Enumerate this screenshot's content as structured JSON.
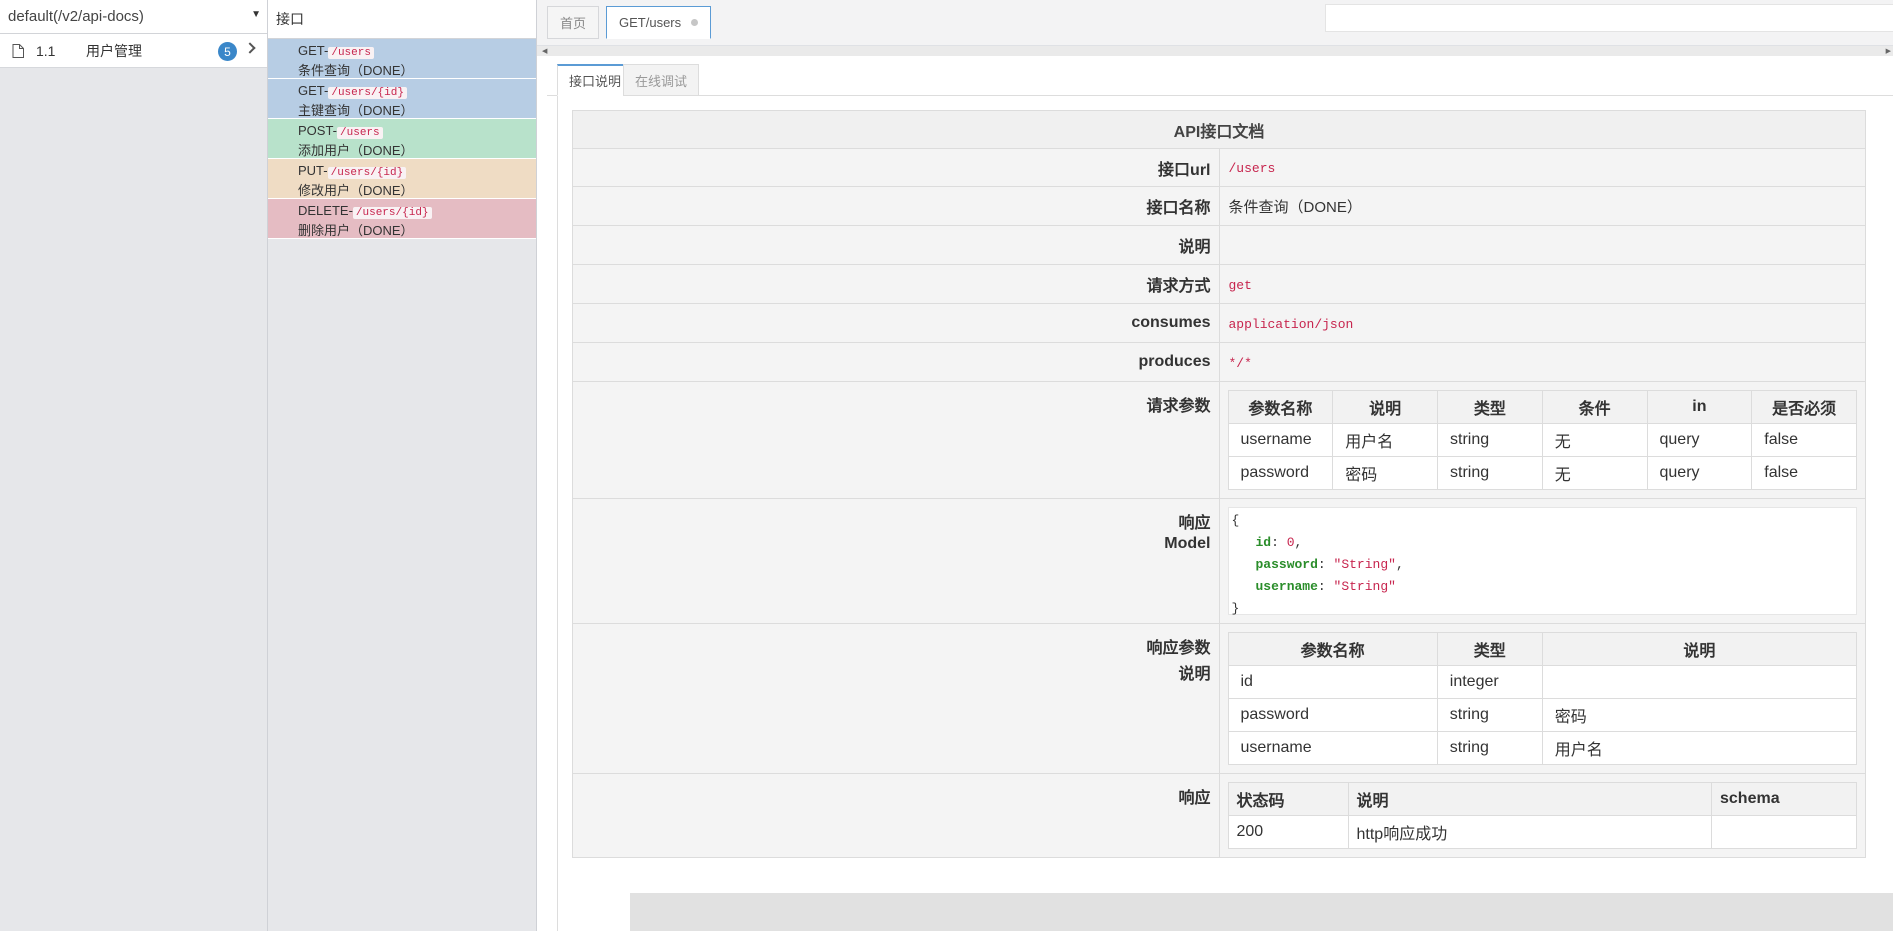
{
  "left": {
    "api_select": "default(/v2/api-docs)",
    "group": {
      "index": "1.1",
      "name": "用户管理",
      "count": "5"
    }
  },
  "middle": {
    "header": "接口",
    "endpoints": [
      {
        "method": "GET-",
        "path": "/users",
        "name": "条件查询（DONE）"
      },
      {
        "method": "GET-",
        "path": "/users/{id}",
        "name": "主键查询（DONE）"
      },
      {
        "method": "POST-",
        "path": "/users",
        "name": "添加用户（DONE）"
      },
      {
        "method": "PUT-",
        "path": "/users/{id}",
        "name": "修改用户（DONE）"
      },
      {
        "method": "DELETE-",
        "path": "/users/{id}",
        "name": "删除用户（DONE）"
      }
    ]
  },
  "tabs": {
    "home": "首页",
    "current": "GET/users"
  },
  "subtabs": {
    "desc": "接口说明",
    "debug": "在线调试"
  },
  "doc": {
    "title": "API接口文档",
    "labels": {
      "url": "接口url",
      "name": "接口名称",
      "desc": "说明",
      "method": "请求方式",
      "consumes": "consumes",
      "produces": "produces",
      "params": "请求参数",
      "model_1": "响应",
      "model_2": "Model",
      "resp_params_1": "响应参数",
      "resp_params_2": "说明",
      "response": "响应"
    },
    "url": "/users",
    "name": "条件查询（DONE）",
    "desc": "",
    "method": "get",
    "consumes": "application/json",
    "produces": "*/*",
    "params_headers": [
      "参数名称",
      "说明",
      "类型",
      "条件",
      "in",
      "是否必须"
    ],
    "params_rows": [
      [
        "username",
        "用户名",
        "string",
        "无",
        "query",
        "false"
      ],
      [
        "password",
        "密码",
        "string",
        "无",
        "query",
        "false"
      ]
    ],
    "model": {
      "open": "{",
      "close": "}",
      "lines": [
        {
          "key": "id",
          "value": "0",
          "trail": ","
        },
        {
          "key": "password",
          "value": "\"String\"",
          "trail": ","
        },
        {
          "key": "username",
          "value": "\"String\"",
          "trail": ""
        }
      ]
    },
    "resp_headers": [
      "参数名称",
      "类型",
      "说明"
    ],
    "resp_rows": [
      [
        "id",
        "integer",
        ""
      ],
      [
        "password",
        "string",
        "密码"
      ],
      [
        "username",
        "string",
        "用户名"
      ]
    ],
    "status_headers": [
      "状态码",
      "说明",
      "schema"
    ],
    "status_rows": [
      [
        "200",
        "http响应成功",
        ""
      ]
    ]
  }
}
